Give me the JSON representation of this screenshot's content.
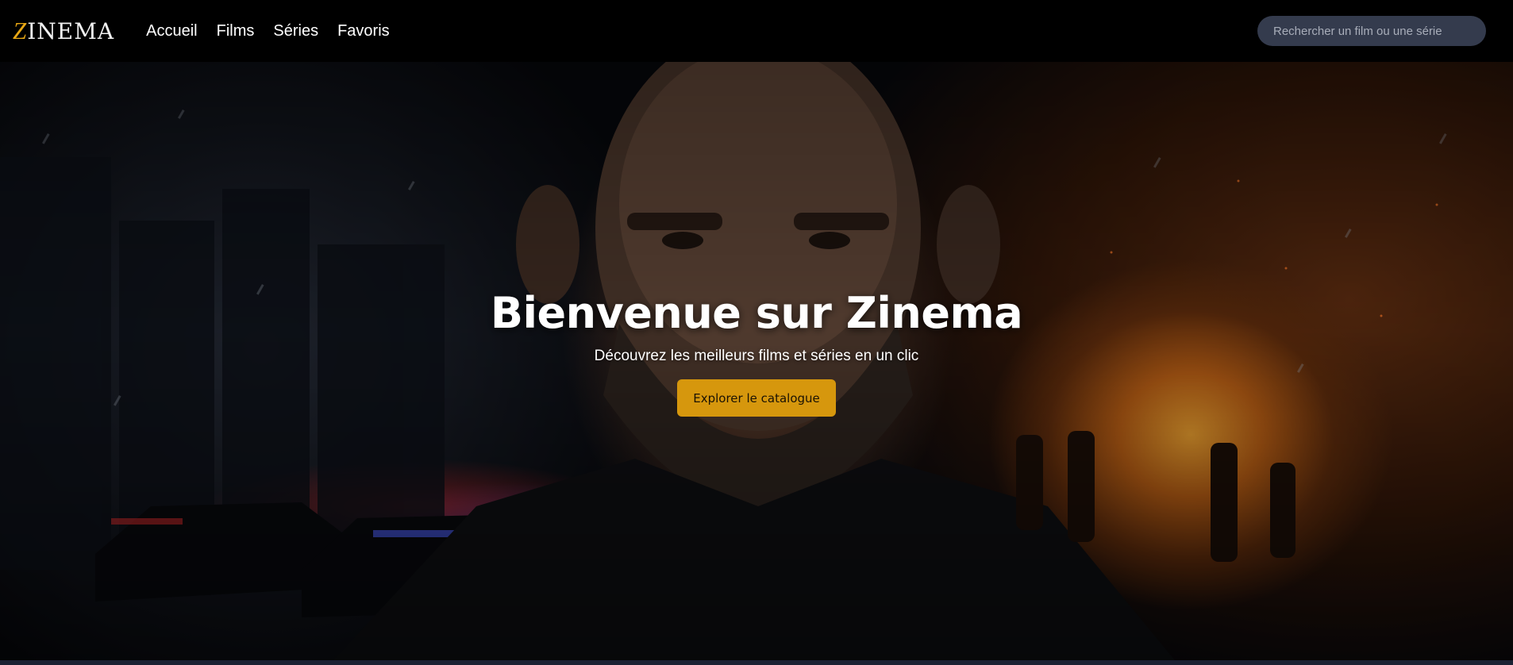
{
  "brand": {
    "logo_initial": "Z",
    "logo_rest": "INEMA",
    "accent_color": "#d6970d"
  },
  "nav": {
    "links": [
      {
        "label": "Accueil"
      },
      {
        "label": "Films"
      },
      {
        "label": "Séries"
      },
      {
        "label": "Favoris"
      }
    ]
  },
  "search": {
    "placeholder": "Rechercher un film ou une série",
    "value": ""
  },
  "hero": {
    "title": "Bienvenue sur Zinema",
    "subtitle": "Découvrez les meilleurs films et séries en un clic",
    "cta_label": "Explorer le catalogue"
  }
}
